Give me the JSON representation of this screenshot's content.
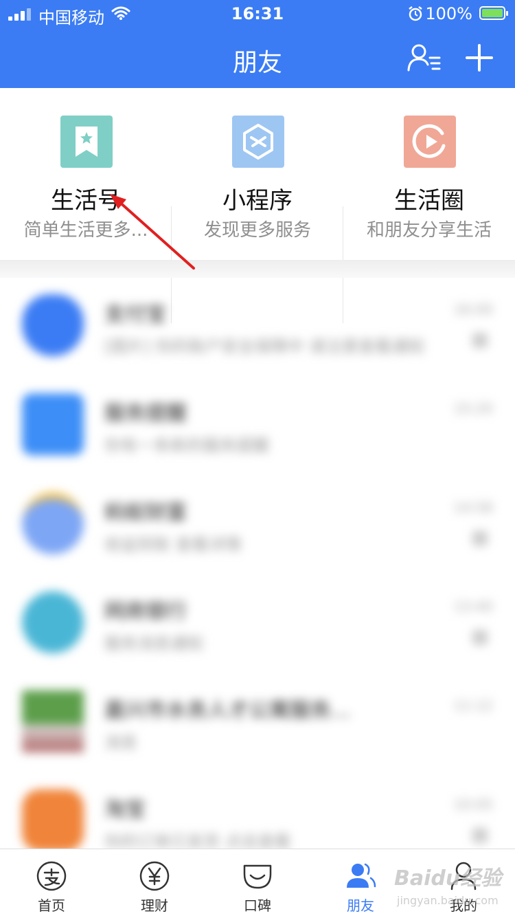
{
  "status_bar": {
    "carrier": "中国移动",
    "time": "16:31",
    "battery": "100%"
  },
  "nav": {
    "title": "朋友"
  },
  "shortcuts": [
    {
      "title": "生活号",
      "subtitle": "简单生活更多...",
      "icon": "bookmark-star-icon",
      "color": "#7fcfc6"
    },
    {
      "title": "小程序",
      "subtitle": "发现更多服务",
      "icon": "mini-program-icon",
      "color": "#9ec6f2"
    },
    {
      "title": "生活圈",
      "subtitle": "和朋友分享生活",
      "icon": "life-circle-icon",
      "color": "#f0a796"
    }
  ],
  "conversations": [
    {
      "name": "支付宝",
      "preview": "[图片] 你的账户安全保障中 请注意查看通知",
      "time": "16:00",
      "avatar_color": "#3b7cf4"
    },
    {
      "name": "服务提醒",
      "preview": "你有一条新的服务提醒",
      "time": "15:20",
      "avatar_color": "#3d8ef7"
    },
    {
      "name": "蚂蚁财富",
      "preview": "收益到账 查看详情",
      "time": "14:58",
      "avatar_color": "#f3c24f"
    },
    {
      "name": "网商银行",
      "preview": "服务消息通知",
      "time": "13:40",
      "avatar_color": "#4ab6d6"
    },
    {
      "name": "嘉兴市水务人才公寓服务...",
      "preview": "消息",
      "time": "11:12",
      "avatar_color": "#5c9e4a"
    },
    {
      "name": "淘宝",
      "preview": "你的订单已发货 点击查看",
      "time": "10:05",
      "avatar_color": "#f0843a"
    }
  ],
  "tabs": [
    {
      "label": "首页",
      "icon": "alipay-home-icon"
    },
    {
      "label": "理财",
      "icon": "wealth-yen-icon"
    },
    {
      "label": "口碑",
      "icon": "koubei-icon"
    },
    {
      "label": "朋友",
      "icon": "friends-icon",
      "active": true
    },
    {
      "label": "我的",
      "icon": "profile-icon"
    }
  ],
  "watermark": {
    "text": "Baidu经验",
    "sub": "jingyan.baidu.com"
  }
}
